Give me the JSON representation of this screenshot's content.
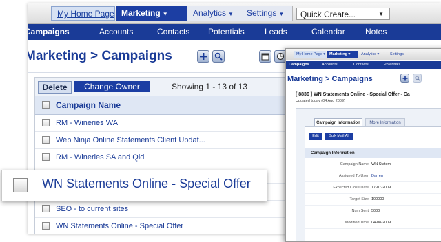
{
  "main": {
    "tabs": [
      {
        "label": "My Home Page"
      },
      {
        "label": "Marketing"
      },
      {
        "label": "Analytics"
      },
      {
        "label": "Settings"
      }
    ],
    "quick_create": "Quick Create...",
    "subnav": [
      "Campaigns",
      "Accounts",
      "Contacts",
      "Potentials",
      "Leads",
      "Calendar",
      "Notes"
    ],
    "page_title": "Marketing > Campaigns",
    "toolbar": {
      "delete_label": "Delete",
      "change_owner_label": "Change Owner",
      "showing": "Showing 1 - 13 of 13"
    },
    "table": {
      "header": "Campaign Name",
      "rows": [
        "RM - Wineries WA",
        "Web Ninja Online Statements Client Updat...",
        "RM - Wineries SA and Qld",
        "",
        "",
        "SEO - to current sites",
        "WN Statements Online - Special Offer"
      ]
    }
  },
  "front": {
    "tabs": [
      "My Home Page",
      "Marketing",
      "Analytics",
      "Settings"
    ],
    "subnav": [
      "Campaigns",
      "Accounts",
      "Contacts",
      "Potentials"
    ],
    "page_title": "Marketing > Campaigns",
    "record_title": "[ 8836 ] WN Statements Online - Special Offer - Ca",
    "updated": "Updated today (04 Aug 2009)",
    "detail_tabs": [
      "Campaign Information",
      "More Information"
    ],
    "buttons": [
      "Edit",
      "Bulk Mail All"
    ],
    "section_title": "Campaign Information",
    "fields": [
      {
        "label": "Campaign Name",
        "value": "WN Statem"
      },
      {
        "label": "Assigned To User",
        "value": "Darren"
      },
      {
        "label": "Expected Close Date",
        "value": "17-07-2009"
      },
      {
        "label": "Target Size",
        "value": "100000"
      },
      {
        "label": "Num Sent",
        "value": "5000"
      },
      {
        "label": "Modified Time",
        "value": "04-08-2009"
      }
    ]
  },
  "magnifier": {
    "text": "WN Statements Online - Special Offer"
  },
  "colors": {
    "nav_blue": "#1a3b97",
    "accent_blue": "#1c3ea3",
    "header_bg": "#dfe7f4"
  }
}
